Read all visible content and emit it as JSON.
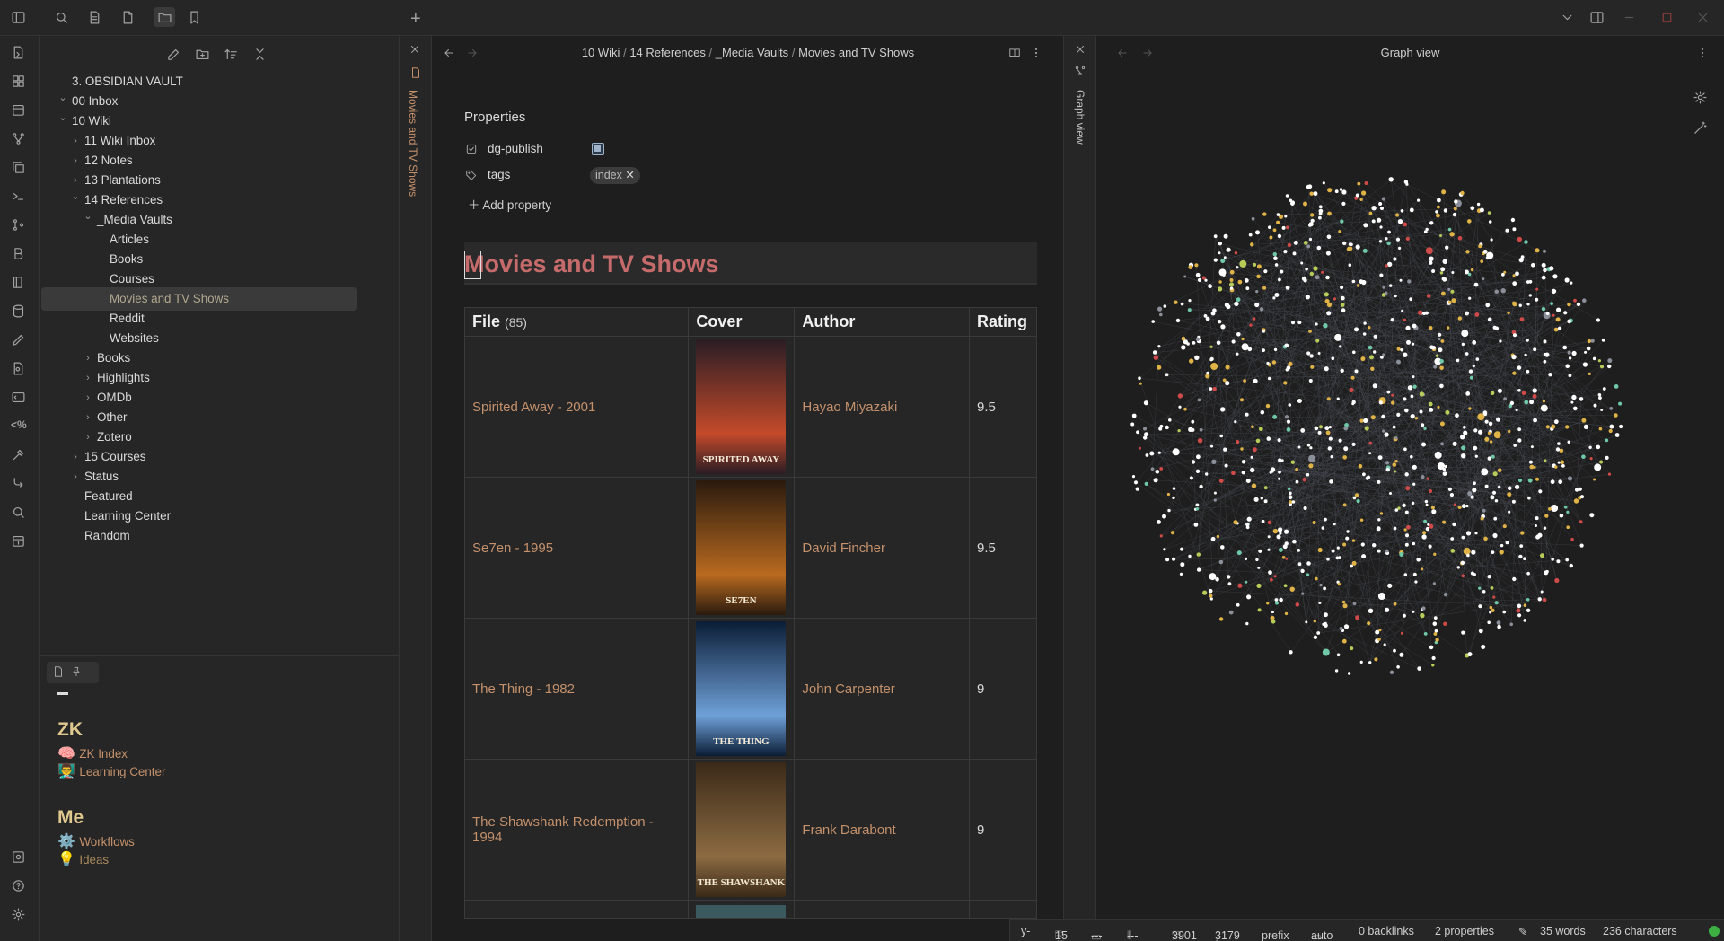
{
  "window": {
    "new_tab": "+"
  },
  "sidebar": {
    "vault_name": "3. OBSIDIAN VAULT",
    "tree": [
      {
        "label": "00 Inbox",
        "chevron": "down"
      },
      {
        "label": "10 Wiki",
        "chevron": "down"
      },
      {
        "label": "11 Wiki Inbox",
        "chevron": "right"
      },
      {
        "label": "12 Notes",
        "chevron": "right"
      },
      {
        "label": "13 Plantations",
        "chevron": "right"
      },
      {
        "label": "14 References",
        "chevron": "down"
      },
      {
        "label": "_Media Vaults",
        "chevron": "down"
      },
      {
        "label": "Articles",
        "chevron": ""
      },
      {
        "label": "Books",
        "chevron": ""
      },
      {
        "label": "Courses",
        "chevron": ""
      },
      {
        "label": "Movies and TV Shows",
        "chevron": "",
        "active": true
      },
      {
        "label": "Reddit",
        "chevron": ""
      },
      {
        "label": "Websites",
        "chevron": ""
      },
      {
        "label": "Books",
        "chevron": "right"
      },
      {
        "label": "Highlights",
        "chevron": "right"
      },
      {
        "label": "OMDb",
        "chevron": "right"
      },
      {
        "label": "Other",
        "chevron": "right"
      },
      {
        "label": "Zotero",
        "chevron": "right"
      },
      {
        "label": "15 Courses",
        "chevron": "right"
      },
      {
        "label": "Status",
        "chevron": "right"
      },
      {
        "label": "Featured",
        "chevron": ""
      },
      {
        "label": "Learning Center",
        "chevron": ""
      },
      {
        "label": "Random",
        "chevron": ""
      }
    ],
    "bottom": {
      "zk_heading": "ZK",
      "zk_links": [
        {
          "emoji": "🧠",
          "label": "ZK Index"
        },
        {
          "emoji": "👨‍🏫",
          "label": "Learning Center"
        }
      ],
      "me_heading": "Me",
      "me_links": [
        {
          "emoji": "⚙️",
          "label": "Workflows"
        },
        {
          "emoji": "💡",
          "label": "Ideas"
        }
      ]
    }
  },
  "editor": {
    "tab_label": "Movies and TV Shows",
    "breadcrumb": [
      "10 Wiki",
      "14 References",
      "_Media Vaults",
      "Movies and TV Shows"
    ],
    "breadcrumb_sep": "/",
    "properties_heading": "Properties",
    "properties": [
      {
        "key": "dg-publish",
        "checked": true
      },
      {
        "key": "tags",
        "tag": "index"
      }
    ],
    "add_property": "Add property",
    "title": "Movies and TV Shows",
    "table": {
      "headers": {
        "file": "File",
        "file_count": "(85)",
        "cover": "Cover",
        "author": "Author",
        "rating": "Rating"
      },
      "rows": [
        {
          "file": "Spirited Away - 2001",
          "author": "Hayao Miyazaki",
          "rating": "9.5",
          "poster_text": "SPIRITED AWAY",
          "poster_colors": [
            "#2a1d24",
            "#c44a2a"
          ]
        },
        {
          "file": "Se7en - 1995",
          "author": "David Fincher",
          "rating": "9.5",
          "poster_text": "SE7EN",
          "poster_colors": [
            "#2a1a0e",
            "#b86a1f"
          ]
        },
        {
          "file": "The Thing - 1982",
          "author": "John Carpenter",
          "rating": "9",
          "poster_text": "THE THING",
          "poster_colors": [
            "#0b1d36",
            "#6fa0d8"
          ]
        },
        {
          "file": "The Shawshank Redemption - 1994",
          "author": "Frank Darabont",
          "rating": "9",
          "poster_text": "THE SHAWSHANK",
          "poster_colors": [
            "#3b2a18",
            "#8c6b42"
          ]
        }
      ]
    }
  },
  "graph": {
    "tab_label": "Graph view",
    "title": "Graph view",
    "node_colors": [
      "#ffffff",
      "#e0b347",
      "#d04a4a",
      "#6fc9a8",
      "#b8cc5a",
      "#8a8f99"
    ]
  },
  "status": {
    "vim_mode": "y-",
    "count1": "15",
    "count2": "---",
    "count3": "---",
    "count4": "3901",
    "count5": "3179",
    "prefix": "prefix",
    "auto": "auto",
    "backlinks": "0 backlinks",
    "properties": "2 properties",
    "words": "35 words",
    "characters": "236 characters"
  }
}
